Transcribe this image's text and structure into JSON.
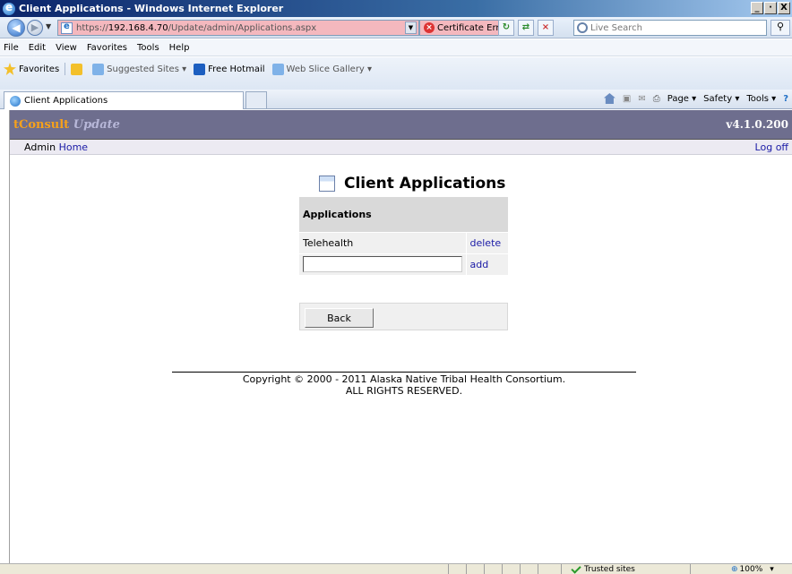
{
  "window": {
    "title": "Client Applications - Windows Internet Explorer",
    "minimize": "_",
    "maximize": "·",
    "close": "X"
  },
  "address": {
    "url_prefix": "https://",
    "url_host": "192.168.4.70",
    "url_path": "/Update/admin/Applications.aspx",
    "cert_error": "Certificate Error",
    "search_placeholder": "Live Search"
  },
  "menu": [
    "File",
    "Edit",
    "View",
    "Favorites",
    "Tools",
    "Help"
  ],
  "favorites": {
    "label": "Favorites",
    "items": [
      "Suggested Sites ▾",
      "Free Hotmail",
      "Web Slice Gallery ▾"
    ]
  },
  "tab": {
    "label": "Client Applications"
  },
  "commands": [
    "Page ▾",
    "Safety ▾",
    "Tools ▾"
  ],
  "app": {
    "brand_main": "tConsult",
    "brand_sub": "Update",
    "version": "v4.1.0.200",
    "admin_label": "Admin",
    "home_link": "Home",
    "logoff_link": "Log off"
  },
  "page": {
    "title": "Client Applications",
    "table_header": "Applications",
    "rows": [
      {
        "name": "Telehealth",
        "action": "delete"
      }
    ],
    "add_label": "add",
    "new_value": "",
    "back_label": "Back",
    "copyright_line1": "Copyright © 2000 - 2011 Alaska Native Tribal Health Consortium.",
    "copyright_line2": "ALL RIGHTS RESERVED."
  },
  "status": {
    "zone": "Trusted sites",
    "zoom": "100%"
  }
}
